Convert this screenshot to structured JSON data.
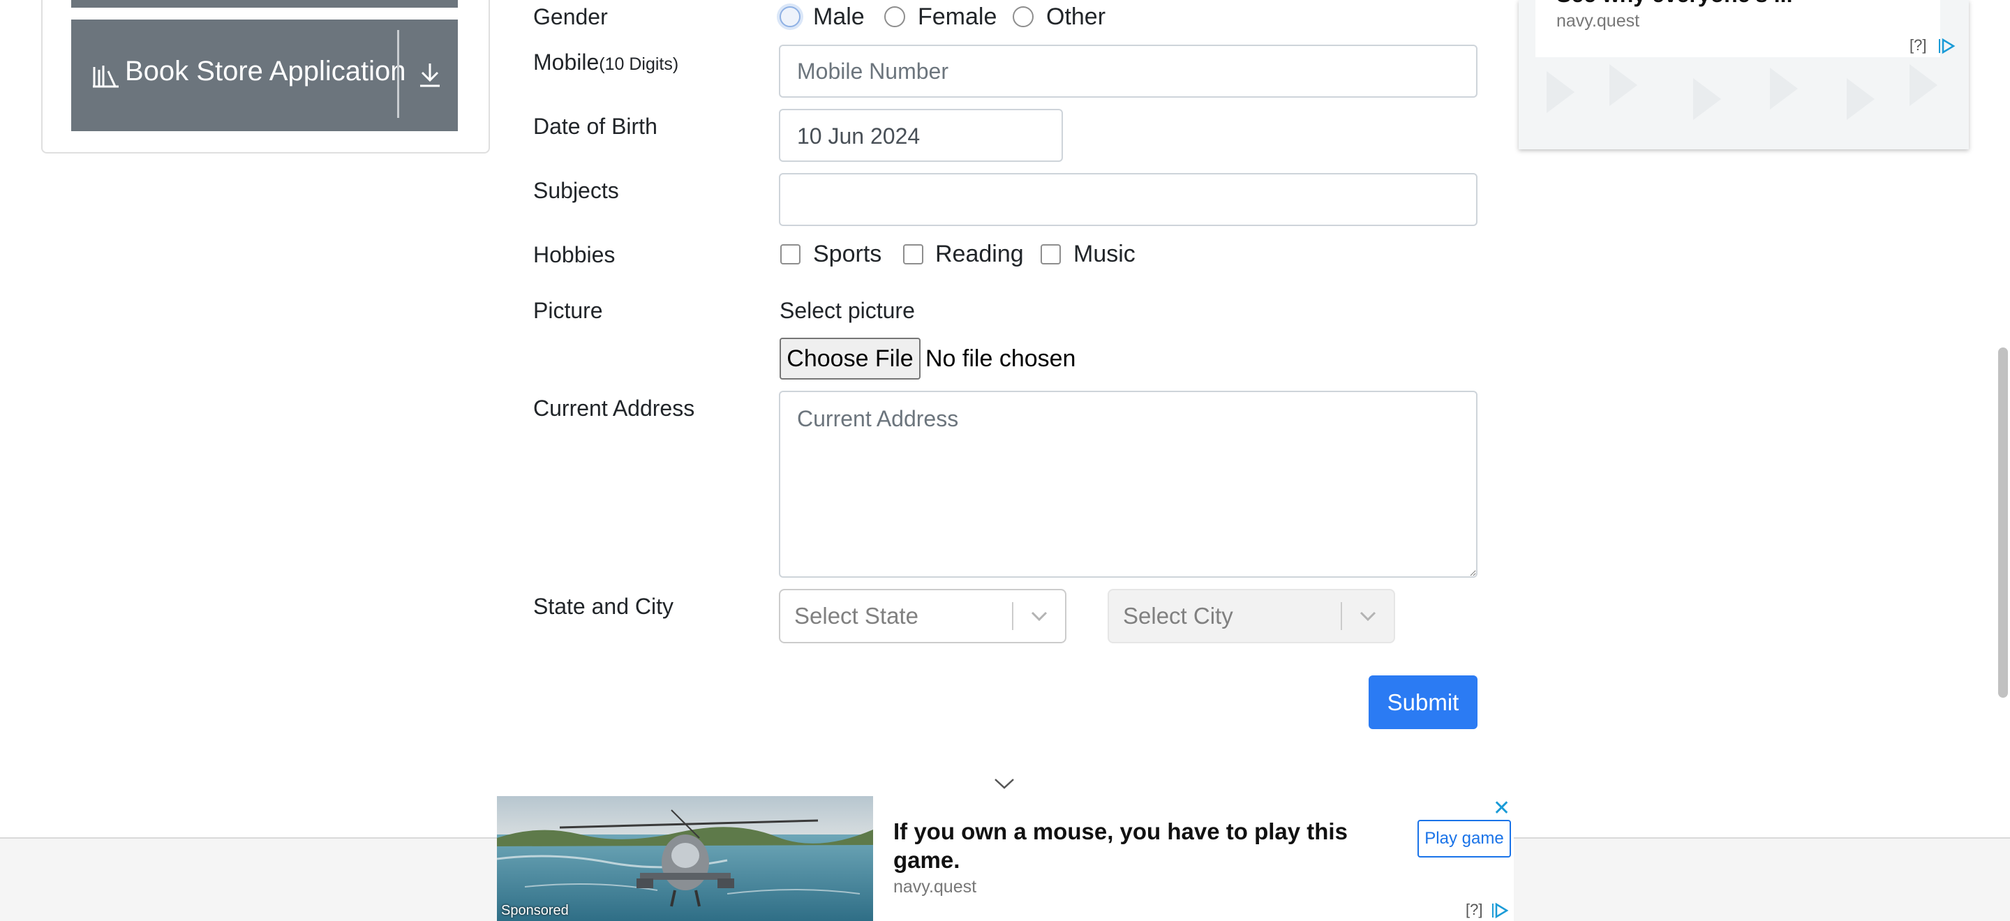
{
  "left_panel": {
    "book_store_label": "Book Store Application"
  },
  "form": {
    "gender": {
      "label": "Gender",
      "options": [
        "Male",
        "Female",
        "Other"
      ],
      "selected": "Male"
    },
    "mobile": {
      "label": "Mobile",
      "hint": "(10 Digits)",
      "placeholder": "Mobile Number"
    },
    "dob": {
      "label": "Date of Birth",
      "value": "10 Jun 2024"
    },
    "subjects": {
      "label": "Subjects"
    },
    "hobbies": {
      "label": "Hobbies",
      "options": [
        "Sports",
        "Reading",
        "Music"
      ]
    },
    "picture": {
      "label": "Picture",
      "select_label": "Select picture",
      "button": "Choose File",
      "status": "No file chosen"
    },
    "address": {
      "label": "Current Address",
      "placeholder": "Current Address"
    },
    "state_city": {
      "label": "State and City",
      "state_placeholder": "Select State",
      "city_placeholder": "Select City"
    },
    "submit": "Submit"
  },
  "ad_top": {
    "headline_partial": "See why everyone's ...",
    "domain": "navy.quest",
    "adchoices": "[?]"
  },
  "ad_bottom": {
    "headline": "If you own a mouse, you have to play this game.",
    "domain": "navy.quest",
    "cta": "Play game",
    "sponsored": "Sponsored",
    "close": "✕",
    "adchoices": "[?]"
  }
}
